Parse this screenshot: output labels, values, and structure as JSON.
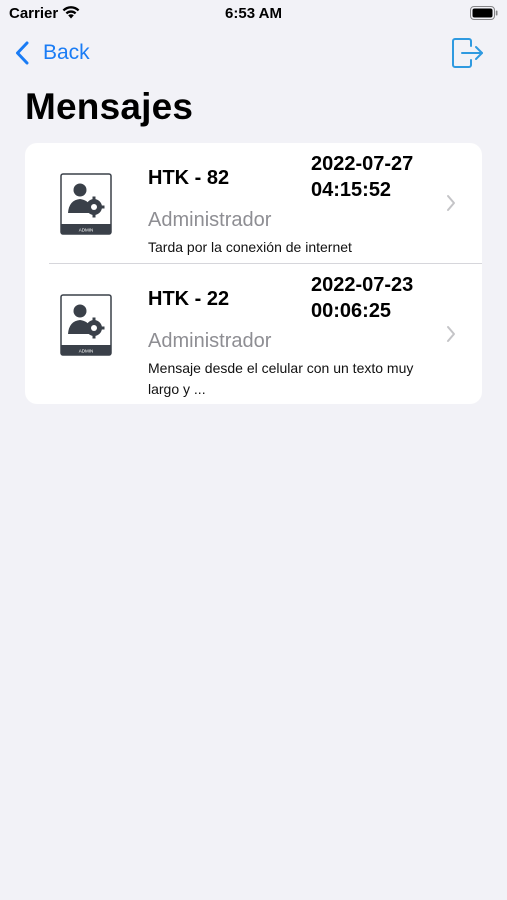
{
  "status_bar": {
    "carrier": "Carrier",
    "time": "6:53 AM",
    "icons": [
      "wifi-icon",
      "battery-icon"
    ]
  },
  "nav": {
    "back_label": "Back",
    "back_icon": "chevron-left-icon",
    "logout_icon": "logout-icon",
    "accent_color": "#1a7cf5",
    "logout_color": "#2f9ae0"
  },
  "page": {
    "title": "Mensajes"
  },
  "messages": [
    {
      "code": "HTK - 82",
      "date": "2022-07-27",
      "time": "04:15:52",
      "sender": "Administrador",
      "text": "Tarda por la conexión de internet",
      "avatar_icon": "admin-avatar-icon"
    },
    {
      "code": "HTK - 22",
      "date": "2022-07-23",
      "time": "00:06:25",
      "sender": "Administrador",
      "text": "Mensaje desde el celular con un texto muy largo y ...",
      "avatar_icon": "admin-avatar-icon"
    }
  ]
}
